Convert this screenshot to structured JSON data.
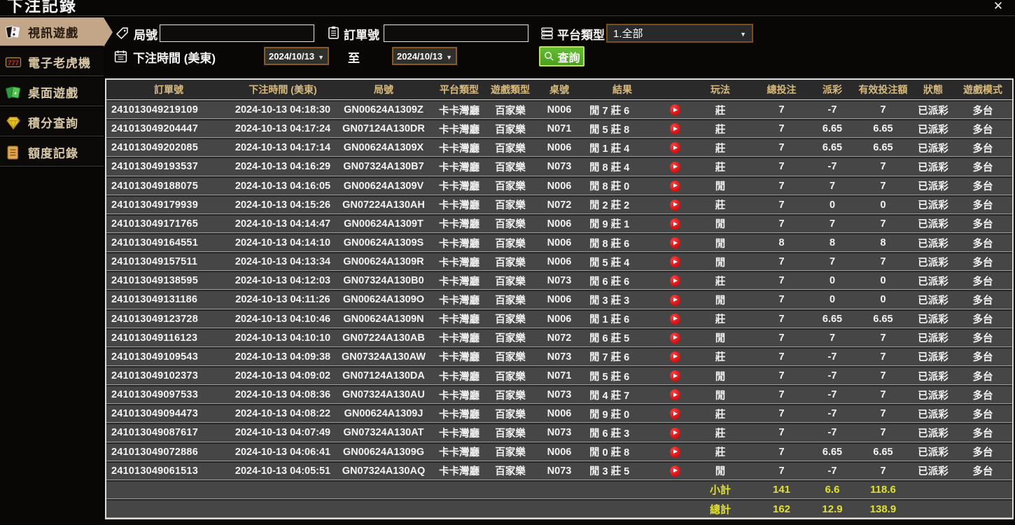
{
  "page": {
    "title": "下注記錄",
    "close_icon": "close-x-icon"
  },
  "colors": {
    "selected_tab_bg": "#c3a687",
    "header_gold": "#d8ba7c",
    "payout_positive": "#43d61e",
    "payout_negative": "#9e1b24",
    "status_green": "#2ae04c",
    "totals_yellow": "#e2e22a",
    "search_button_green": "#4ba01c",
    "date_border_orange": "#8a5a26"
  },
  "sidebar": {
    "items": [
      {
        "label": "視訊遊戲",
        "icon": "video-cards-icon",
        "selected": true
      },
      {
        "label": "電子老虎機",
        "icon": "slots-777-icon",
        "selected": false
      },
      {
        "label": "桌面遊戲",
        "icon": "table-cards-icon",
        "selected": false
      },
      {
        "label": "積分查詢",
        "icon": "points-gem-icon",
        "selected": false
      },
      {
        "label": "額度記錄",
        "icon": "quota-doc-icon",
        "selected": false
      }
    ]
  },
  "filters": {
    "round_label": "局號",
    "round_value": "",
    "order_label": "訂單號",
    "order_value": "",
    "platform_label": "平台類型",
    "platform_value": "1.全部",
    "time_label": "下注時間 (美東)",
    "date_from": "2024/10/13",
    "to_label": "至",
    "date_to": "2024/10/13",
    "search_label": "查詢"
  },
  "table": {
    "headers": [
      "訂單號",
      "下注時間 (美東)",
      "局號",
      "平台類型",
      "遊戲類型",
      "桌號",
      "結果",
      "",
      "玩法",
      "總投注",
      "派彩",
      "有效投注額",
      "狀態",
      "遊戲模式"
    ],
    "rows": [
      {
        "order": "241013049219109",
        "time": "2024-10-13 04:18:30",
        "round": "GN00624A1309Z",
        "platform": "卡卡灣廳",
        "game": "百家樂",
        "table_no": "N006",
        "result": "閒 7 莊 6",
        "bet_on": "莊",
        "total_bet": "7",
        "payout": "-7",
        "valid_bet": "7",
        "status": "已派彩",
        "mode": "多台"
      },
      {
        "order": "241013049204447",
        "time": "2024-10-13 04:17:24",
        "round": "GN07124A130DR",
        "platform": "卡卡灣廳",
        "game": "百家樂",
        "table_no": "N071",
        "result": "閒 5 莊 8",
        "bet_on": "莊",
        "total_bet": "7",
        "payout": "6.65",
        "valid_bet": "6.65",
        "status": "已派彩",
        "mode": "多台"
      },
      {
        "order": "241013049202085",
        "time": "2024-10-13 04:17:14",
        "round": "GN00624A1309X",
        "platform": "卡卡灣廳",
        "game": "百家樂",
        "table_no": "N006",
        "result": "閒 1 莊 4",
        "bet_on": "莊",
        "total_bet": "7",
        "payout": "6.65",
        "valid_bet": "6.65",
        "status": "已派彩",
        "mode": "多台"
      },
      {
        "order": "241013049193537",
        "time": "2024-10-13 04:16:29",
        "round": "GN07324A130B7",
        "platform": "卡卡灣廳",
        "game": "百家樂",
        "table_no": "N073",
        "result": "閒 8 莊 4",
        "bet_on": "莊",
        "total_bet": "7",
        "payout": "-7",
        "valid_bet": "7",
        "status": "已派彩",
        "mode": "多台"
      },
      {
        "order": "241013049188075",
        "time": "2024-10-13 04:16:05",
        "round": "GN00624A1309V",
        "platform": "卡卡灣廳",
        "game": "百家樂",
        "table_no": "N006",
        "result": "閒 8 莊 0",
        "bet_on": "閒",
        "total_bet": "7",
        "payout": "7",
        "valid_bet": "7",
        "status": "已派彩",
        "mode": "多台"
      },
      {
        "order": "241013049179939",
        "time": "2024-10-13 04:15:26",
        "round": "GN07224A130AH",
        "platform": "卡卡灣廳",
        "game": "百家樂",
        "table_no": "N072",
        "result": "閒 2 莊 2",
        "bet_on": "莊",
        "total_bet": "7",
        "payout": "0",
        "valid_bet": "0",
        "status": "已派彩",
        "mode": "多台"
      },
      {
        "order": "241013049171765",
        "time": "2024-10-13 04:14:47",
        "round": "GN00624A1309T",
        "platform": "卡卡灣廳",
        "game": "百家樂",
        "table_no": "N006",
        "result": "閒 9 莊 1",
        "bet_on": "閒",
        "total_bet": "7",
        "payout": "7",
        "valid_bet": "7",
        "status": "已派彩",
        "mode": "多台"
      },
      {
        "order": "241013049164551",
        "time": "2024-10-13 04:14:10",
        "round": "GN00624A1309S",
        "platform": "卡卡灣廳",
        "game": "百家樂",
        "table_no": "N006",
        "result": "閒 8 莊 6",
        "bet_on": "閒",
        "total_bet": "8",
        "payout": "8",
        "valid_bet": "8",
        "status": "已派彩",
        "mode": "多台"
      },
      {
        "order": "241013049157511",
        "time": "2024-10-13 04:13:34",
        "round": "GN00624A1309R",
        "platform": "卡卡灣廳",
        "game": "百家樂",
        "table_no": "N006",
        "result": "閒 5 莊 4",
        "bet_on": "閒",
        "total_bet": "7",
        "payout": "7",
        "valid_bet": "7",
        "status": "已派彩",
        "mode": "多台"
      },
      {
        "order": "241013049138595",
        "time": "2024-10-13 04:12:03",
        "round": "GN07324A130B0",
        "platform": "卡卡灣廳",
        "game": "百家樂",
        "table_no": "N073",
        "result": "閒 6 莊 6",
        "bet_on": "莊",
        "total_bet": "7",
        "payout": "0",
        "valid_bet": "0",
        "status": "已派彩",
        "mode": "多台"
      },
      {
        "order": "241013049131186",
        "time": "2024-10-13 04:11:26",
        "round": "GN00624A1309O",
        "platform": "卡卡灣廳",
        "game": "百家樂",
        "table_no": "N006",
        "result": "閒 3 莊 3",
        "bet_on": "閒",
        "total_bet": "7",
        "payout": "0",
        "valid_bet": "0",
        "status": "已派彩",
        "mode": "多台"
      },
      {
        "order": "241013049123728",
        "time": "2024-10-13 04:10:46",
        "round": "GN00624A1309N",
        "platform": "卡卡灣廳",
        "game": "百家樂",
        "table_no": "N006",
        "result": "閒 1 莊 6",
        "bet_on": "莊",
        "total_bet": "7",
        "payout": "6.65",
        "valid_bet": "6.65",
        "status": "已派彩",
        "mode": "多台"
      },
      {
        "order": "241013049116123",
        "time": "2024-10-13 04:10:10",
        "round": "GN07224A130AB",
        "platform": "卡卡灣廳",
        "game": "百家樂",
        "table_no": "N072",
        "result": "閒 6 莊 5",
        "bet_on": "閒",
        "total_bet": "7",
        "payout": "7",
        "valid_bet": "7",
        "status": "已派彩",
        "mode": "多台"
      },
      {
        "order": "241013049109543",
        "time": "2024-10-13 04:09:38",
        "round": "GN07324A130AW",
        "platform": "卡卡灣廳",
        "game": "百家樂",
        "table_no": "N073",
        "result": "閒 7 莊 6",
        "bet_on": "莊",
        "total_bet": "7",
        "payout": "-7",
        "valid_bet": "7",
        "status": "已派彩",
        "mode": "多台"
      },
      {
        "order": "241013049102373",
        "time": "2024-10-13 04:09:02",
        "round": "GN07124A130DA",
        "platform": "卡卡灣廳",
        "game": "百家樂",
        "table_no": "N071",
        "result": "閒 5 莊 6",
        "bet_on": "閒",
        "total_bet": "7",
        "payout": "-7",
        "valid_bet": "7",
        "status": "已派彩",
        "mode": "多台"
      },
      {
        "order": "241013049097533",
        "time": "2024-10-13 04:08:36",
        "round": "GN07324A130AU",
        "platform": "卡卡灣廳",
        "game": "百家樂",
        "table_no": "N073",
        "result": "閒 4 莊 7",
        "bet_on": "閒",
        "total_bet": "7",
        "payout": "-7",
        "valid_bet": "7",
        "status": "已派彩",
        "mode": "多台"
      },
      {
        "order": "241013049094473",
        "time": "2024-10-13 04:08:22",
        "round": "GN00624A1309J",
        "platform": "卡卡灣廳",
        "game": "百家樂",
        "table_no": "N006",
        "result": "閒 9 莊 0",
        "bet_on": "莊",
        "total_bet": "7",
        "payout": "-7",
        "valid_bet": "7",
        "status": "已派彩",
        "mode": "多台"
      },
      {
        "order": "241013049087617",
        "time": "2024-10-13 04:07:49",
        "round": "GN07324A130AT",
        "platform": "卡卡灣廳",
        "game": "百家樂",
        "table_no": "N073",
        "result": "閒 6 莊 3",
        "bet_on": "莊",
        "total_bet": "7",
        "payout": "-7",
        "valid_bet": "7",
        "status": "已派彩",
        "mode": "多台"
      },
      {
        "order": "241013049072886",
        "time": "2024-10-13 04:06:41",
        "round": "GN00624A1309G",
        "platform": "卡卡灣廳",
        "game": "百家樂",
        "table_no": "N006",
        "result": "閒 0 莊 8",
        "bet_on": "莊",
        "total_bet": "7",
        "payout": "6.65",
        "valid_bet": "6.65",
        "status": "已派彩",
        "mode": "多台"
      },
      {
        "order": "241013049061513",
        "time": "2024-10-13 04:05:51",
        "round": "GN07324A130AQ",
        "platform": "卡卡灣廳",
        "game": "百家樂",
        "table_no": "N073",
        "result": "閒 3 莊 5",
        "bet_on": "閒",
        "total_bet": "7",
        "payout": "-7",
        "valid_bet": "7",
        "status": "已派彩",
        "mode": "多台"
      }
    ],
    "subtotal": {
      "label": "小計",
      "total_bet": "141",
      "payout": "6.6",
      "valid_bet": "118.6"
    },
    "total": {
      "label": "總計",
      "total_bet": "162",
      "payout": "12.9",
      "valid_bet": "138.9"
    }
  }
}
